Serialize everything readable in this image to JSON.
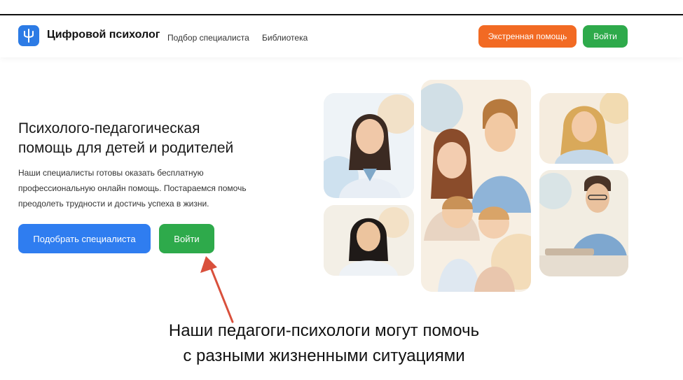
{
  "header": {
    "brand": "Цифровой психолог",
    "nav": [
      "Подбор специалиста",
      "Библиотека"
    ],
    "emergency_label": "Экстренная помощь",
    "login_label": "Войти"
  },
  "hero": {
    "title_line1": "Психолого-педагогическая",
    "title_line2": "помощь для детей и родителей",
    "text_line1": "Наши специалисты готовы оказать бесплатную",
    "text_line2": "профессиональную онлайн помощь. Постараемся помочь",
    "text_line3": "преодолеть трудности и достичь успеха в жизни.",
    "find_button": "Подобрать специалиста",
    "login_button": "Войти"
  },
  "caption": {
    "line1": "Наши педагоги-психологи могут помочь",
    "line2": "с разными жизненными ситуациями"
  },
  "colors": {
    "brand_blue": "#2c7be5",
    "emergency_orange": "#f26a23",
    "login_green": "#2eaa4b",
    "find_blue": "#2f7df0",
    "arrow_red": "#d9503c"
  },
  "icons": {
    "logo": "psi-icon",
    "arrow": "annotation-arrow-icon"
  }
}
